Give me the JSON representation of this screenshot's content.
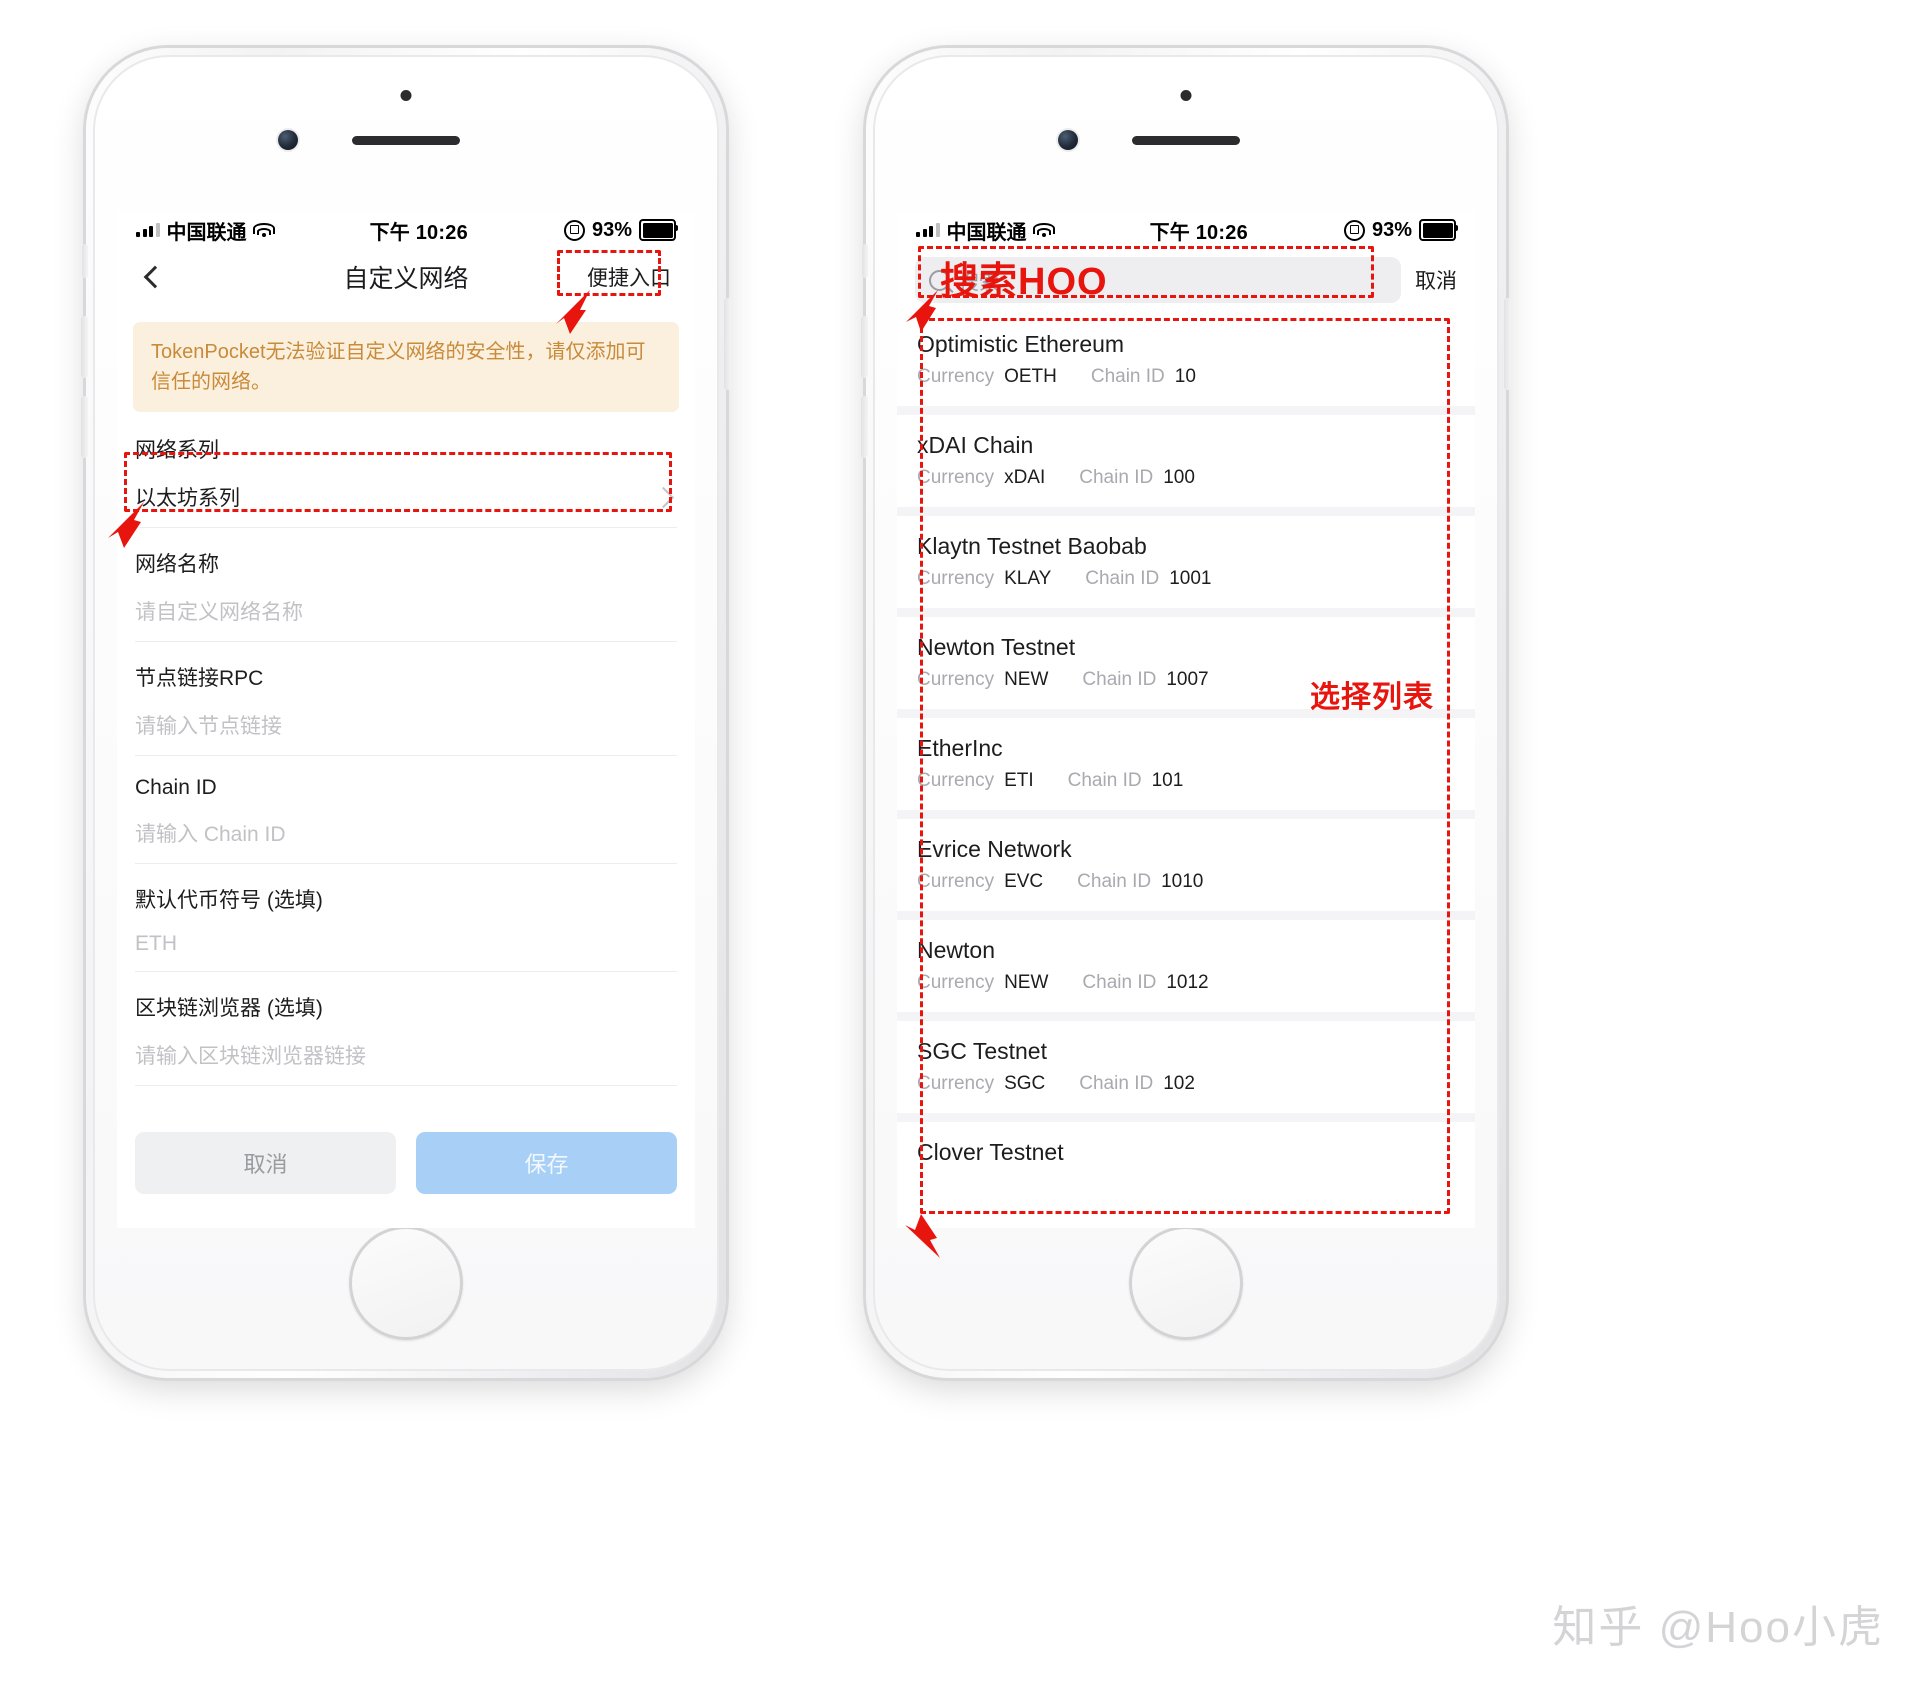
{
  "statusbar": {
    "carrier": "中国联通",
    "time": "下午 10:26",
    "battery_percent": "93%",
    "signal_icon": "signal-bars-icon",
    "wifi_icon": "wifi-icon",
    "rotation_lock_icon": "rotation-lock-icon",
    "battery_icon": "battery-icon"
  },
  "left_phone": {
    "nav": {
      "back_icon": "chevron-left-icon",
      "title": "自定义网络",
      "action_label": "便捷入口"
    },
    "warning": "TokenPocket无法验证自定义网络的安全性，请仅添加可信任的网络。",
    "fields": [
      {
        "label": "网络系列",
        "value": "以太坊系列",
        "placeholder": "",
        "type": "select",
        "chevron_icon": "chevron-right-icon"
      },
      {
        "label": "网络名称",
        "value": "",
        "placeholder": "请自定义网络名称",
        "type": "text"
      },
      {
        "label": "节点链接RPC",
        "value": "",
        "placeholder": "请输入节点链接",
        "type": "text"
      },
      {
        "label": "Chain ID",
        "value": "",
        "placeholder": "请输入 Chain ID",
        "type": "text"
      },
      {
        "label": "默认代币符号 (选填)",
        "value": "",
        "placeholder": "ETH",
        "type": "text"
      },
      {
        "label": "区块链浏览器 (选填)",
        "value": "",
        "placeholder": "请输入区块链浏览器链接",
        "type": "text"
      }
    ],
    "buttons": {
      "cancel": "取消",
      "save": "保存"
    }
  },
  "right_phone": {
    "search": {
      "placeholder": "搜索",
      "search_icon": "search-icon",
      "cancel_label": "取消"
    },
    "meta_labels": {
      "currency": "Currency",
      "chain_id": "Chain ID"
    },
    "networks": [
      {
        "name": "Optimistic Ethereum",
        "currency": "OETH",
        "chain_id": "10"
      },
      {
        "name": "xDAI Chain",
        "currency": "xDAI",
        "chain_id": "100"
      },
      {
        "name": "Klaytn Testnet Baobab",
        "currency": "KLAY",
        "chain_id": "1001"
      },
      {
        "name": "Newton Testnet",
        "currency": "NEW",
        "chain_id": "1007"
      },
      {
        "name": "EtherInc",
        "currency": "ETI",
        "chain_id": "101"
      },
      {
        "name": "Evrice Network",
        "currency": "EVC",
        "chain_id": "1010"
      },
      {
        "name": "Newton",
        "currency": "NEW",
        "chain_id": "1012"
      },
      {
        "name": "SGC Testnet",
        "currency": "SGC",
        "chain_id": "102"
      },
      {
        "name": "Clover Testnet",
        "currency": "",
        "chain_id": ""
      }
    ]
  },
  "annotations": {
    "search_overlay_text": "搜索HOO",
    "select_list_text": "选择列表",
    "accent_color": "#e8150f"
  },
  "watermark": "知乎 @Hoo小虎"
}
